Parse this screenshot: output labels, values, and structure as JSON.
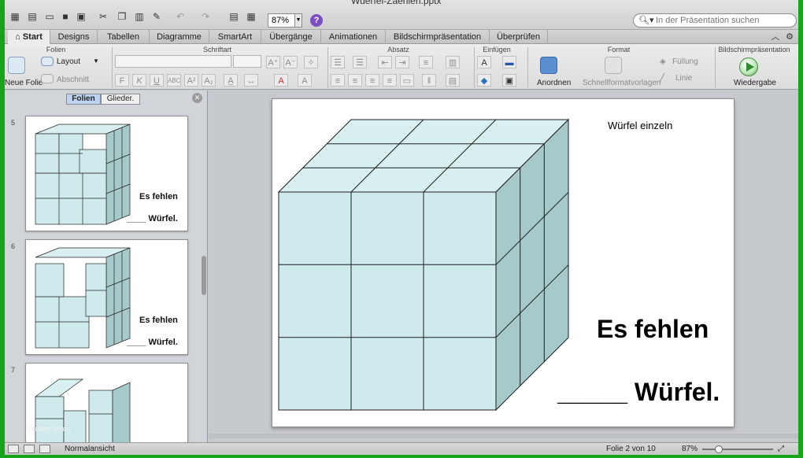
{
  "window": {
    "title": "Wuerfel-Zaehlen.pptx"
  },
  "search": {
    "placeholder": "In der Präsentation suchen"
  },
  "toolbar": {
    "zoom": "87%"
  },
  "tabs": [
    "Start",
    "Designs",
    "Tabellen",
    "Diagramme",
    "SmartArt",
    "Übergänge",
    "Animationen",
    "Bildschirmpräsentation",
    "Überprüfen"
  ],
  "ribbon": {
    "groups": [
      "Folien",
      "Schriftart",
      "Absatz",
      "Einfügen",
      "Format",
      "Bildschirmpräsentation"
    ],
    "new_slide": "Neue Folie",
    "layout": "Layout",
    "section": "Abschnitt",
    "arrange": "Anordnen",
    "quick_styles": "Schnellformatvorlagen",
    "fill": "Füllung",
    "line": "Linie",
    "play": "Wiedergabe"
  },
  "pane": {
    "tabs": [
      "Folien",
      "Glieder."
    ],
    "thumbnails": [
      {
        "number": "5",
        "line1": "Es fehlen",
        "line2": "____ Würfel."
      },
      {
        "number": "6",
        "line1": "Es fehlen",
        "line2": "____ Würfel."
      },
      {
        "number": "7"
      }
    ],
    "watermark": "Vorlage Ideen"
  },
  "slide": {
    "corner_label": "Würfel einzeln",
    "line1": "Es fehlen",
    "line2": "_____ Würfel."
  },
  "status": {
    "view": "Normalansicht",
    "slide_counter": "Folie 2 von 10",
    "zoom": "87%"
  },
  "colors": {
    "cube_front": "#cfeaec",
    "cube_top": "#d9f0f1",
    "cube_side": "#a6c9c9",
    "active_tab": "#bcd4f1",
    "frame": "#17a31a"
  }
}
